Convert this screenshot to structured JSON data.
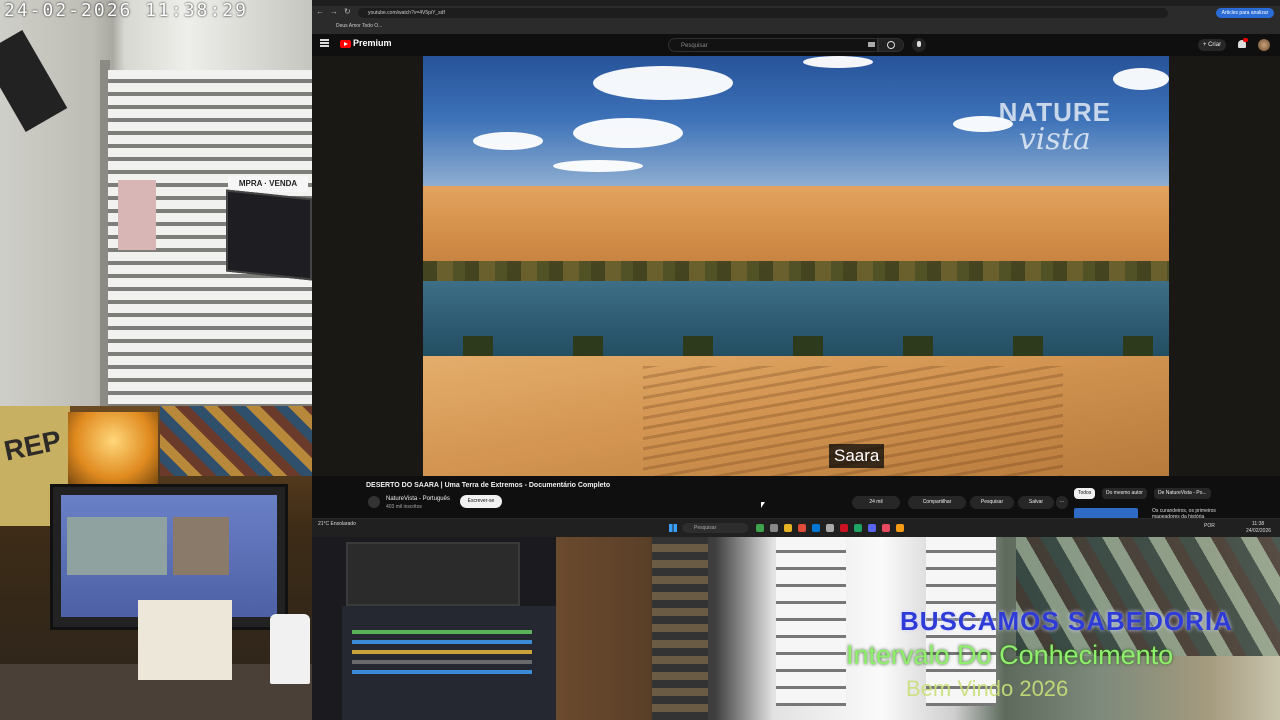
{
  "cameras": {
    "timestamp": "24-02-2026 11:38:29",
    "street_sign": "MPRA · VENDA",
    "desk_poster": "REP"
  },
  "overlay": {
    "line1": "BUSCAMOS SABEDORIA",
    "line2": "Intervalo Do Conhecimento",
    "line3": "Bem Vindo 2026"
  },
  "browser": {
    "url": "youtube.com/watch?v=4V5piY_sdf",
    "bookmark": "Deus Amor Todo O...",
    "sidebar_button": "Articles para analizar"
  },
  "youtube": {
    "brand": "Premium",
    "search_placeholder": "Pesquisar",
    "create_label": "+ Criar",
    "video": {
      "watermark_line1": "NATURE",
      "watermark_line2": "vista",
      "subtitle": "Saara",
      "title": "DESERTO DO SAARA | Uma Terra de Extremos - Documentário Completo"
    },
    "channel": {
      "name": "NatureVista - Português",
      "subscribers": "403 mil inscritos",
      "subscribe_label": "Escrever-se"
    },
    "actions": {
      "like_count": "24 mil",
      "share": "Compartilhar",
      "save": "Salvar",
      "clip": "Pesquisar",
      "more": "···"
    },
    "chips": [
      "Todos",
      "Do mesmo autor",
      "De NatureVista - Po..."
    ],
    "recommended_title": "Os curandeiros, os primeiros mapeadores da história"
  },
  "taskbar": {
    "weather": "21°C Ensolarado",
    "search_placeholder": "Pesquisar",
    "lang": "POR",
    "time": "11:38",
    "date": "24/02/2026"
  },
  "colors": {
    "yt_red": "#ff0000",
    "overlay_blue": "#2e3bd6",
    "overlay_green": "#8ef06b",
    "overlay_yellow": "#c9e079"
  }
}
